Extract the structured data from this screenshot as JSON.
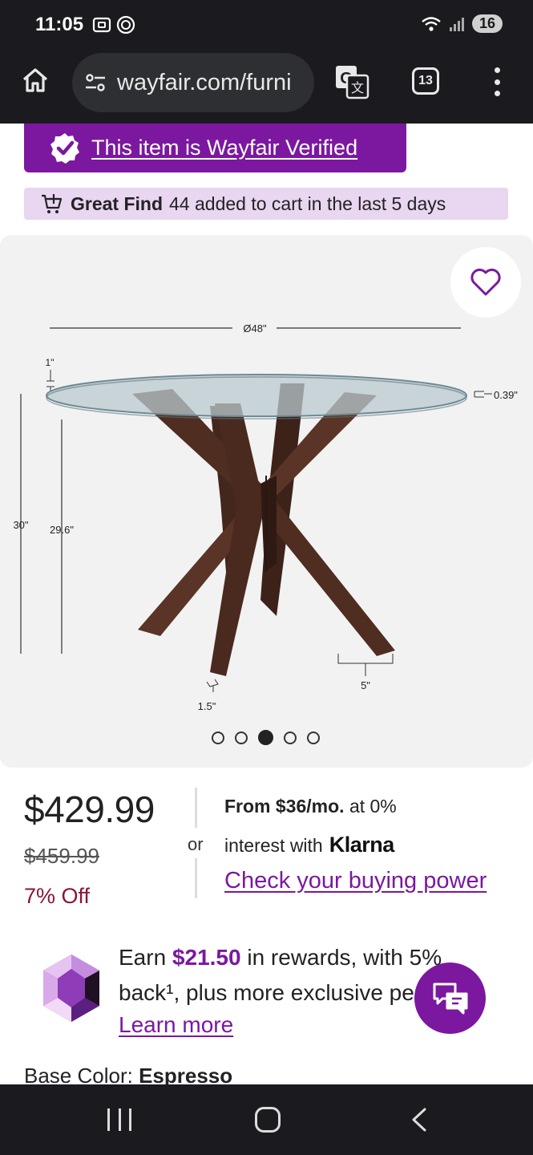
{
  "status_bar": {
    "time": "11:05",
    "battery": "16"
  },
  "browser": {
    "url": "wayfair.com/furni",
    "tab_count": "13"
  },
  "verified_banner": {
    "text": "This item is Wayfair Verified"
  },
  "great_find": {
    "label": "Great Find",
    "text": "44 added to cart in the last 5 days"
  },
  "gallery": {
    "dimensions": {
      "diameter": "Ø48\"",
      "top_thickness": "1\"",
      "glass_thickness": "0.39\"",
      "total_height": "30\"",
      "base_height": "29.6\"",
      "leg_width": "1.5\"",
      "foot_width": "5\""
    },
    "image_count": 5,
    "active_index": 2
  },
  "pricing": {
    "price": "$429.99",
    "original_price": "$459.99",
    "discount": "7% Off",
    "or": "or",
    "financing_from": "From",
    "financing_amount": "$36/mo.",
    "financing_rate": "at 0%",
    "financing_line2": "interest with",
    "klarna": "Klarna",
    "buying_power_link": "Check your buying power"
  },
  "rewards": {
    "earn": "Earn",
    "amount": "$21.50",
    "text1": "in rewards, with 5%",
    "text2": "back¹, plus more exclusive perks",
    "learn_more": "Learn more"
  },
  "options": {
    "base_color_label": "Base Color:",
    "base_color_value": "Espresso"
  },
  "colors": {
    "brand_purple": "#7b189f",
    "discount_red": "#8a1538",
    "wood": "#4a2a1f"
  }
}
